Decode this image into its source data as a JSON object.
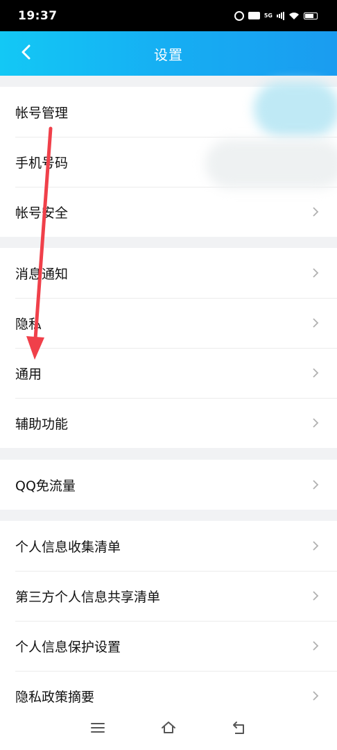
{
  "status_bar": {
    "time": "19:37",
    "icons": [
      "alarm-icon",
      "hd-icon",
      "5g-icon",
      "signal-icon",
      "wifi-icon",
      "battery-icon"
    ],
    "hd_label": "HD",
    "network_label": "5G"
  },
  "header": {
    "title": "设置",
    "back_icon": "chevron-left-icon",
    "gradient": [
      "#13c8f5",
      "#1a9cf0"
    ]
  },
  "groups": [
    {
      "items": [
        {
          "label": "帐号管理"
        },
        {
          "label": "手机号码"
        },
        {
          "label": "帐号安全"
        }
      ]
    },
    {
      "items": [
        {
          "label": "消息通知"
        },
        {
          "label": "隐私"
        },
        {
          "label": "通用"
        },
        {
          "label": "辅助功能"
        }
      ]
    },
    {
      "items": [
        {
          "label": "QQ免流量"
        }
      ]
    },
    {
      "items": [
        {
          "label": "个人信息收集清单"
        },
        {
          "label": "第三方个人信息共享清单"
        },
        {
          "label": "个人信息保护设置"
        },
        {
          "label": "隐私政策摘要"
        }
      ]
    }
  ],
  "annotation": {
    "color": "#f0404a",
    "type": "arrow"
  },
  "nav_bar": {
    "icons": [
      "menu-icon",
      "home-icon",
      "back-icon"
    ]
  }
}
